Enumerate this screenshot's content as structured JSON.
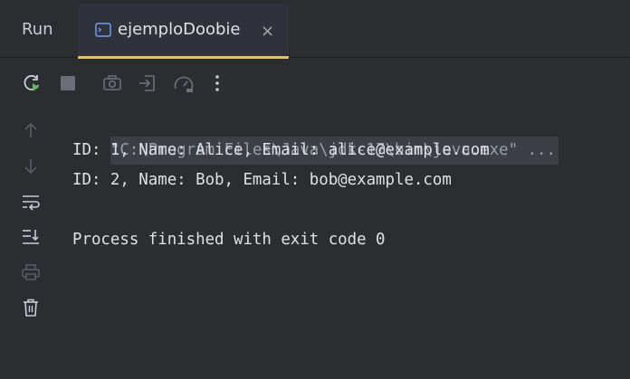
{
  "run_panel": {
    "title": "Run",
    "tab": {
      "label": "ejemploDoobie",
      "close_glyph": "×",
      "icon": "console-window-icon"
    }
  },
  "toolbar": {
    "icons": [
      "rerun-icon",
      "stop-icon",
      "camera-icon",
      "exit-icon",
      "speedometer-icon",
      "more-icon"
    ]
  },
  "sidebar": {
    "icons": [
      "arrow-up-icon",
      "arrow-down-icon",
      "soft-wrap-icon",
      "scroll-to-end-icon",
      "print-icon",
      "trash-icon"
    ]
  },
  "console": {
    "command": "\"C:\\Program Files\\Java\\jdk-17\\bin\\java.exe\" ...",
    "lines": [
      "ID: 1, Name: Alice, Email: alice@example.com",
      "ID: 2, Name: Bob, Email: bob@example.com",
      "",
      "Process finished with exit code 0"
    ]
  },
  "colors": {
    "background": "#2b2d30",
    "tab_accent": "#e8c35c",
    "rerun_green": "#5fb85f",
    "text": "#dfe1e5",
    "command_text": "#9a9ea6"
  }
}
